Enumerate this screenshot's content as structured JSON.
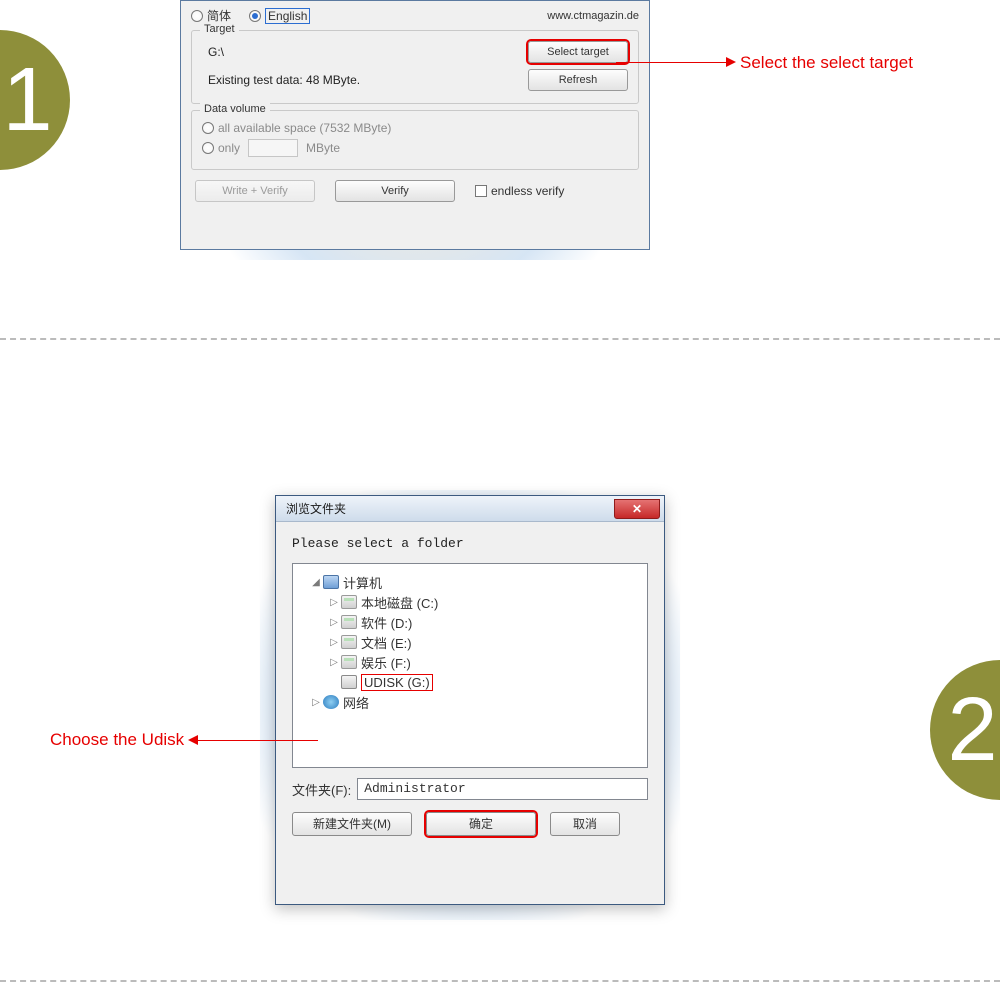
{
  "step1": {
    "badge": "1",
    "lang": {
      "cn": "简体",
      "en": "English"
    },
    "site": "www.ctmagazin.de",
    "target": {
      "group": "Target",
      "drive": "G:\\",
      "select_btn": "Select target",
      "existing": "Existing test data: 48 MByte.",
      "refresh_btn": "Refresh"
    },
    "volume": {
      "group": "Data volume",
      "all": "all available space (7532 MByte)",
      "only": "only",
      "unit": "MByte"
    },
    "actions": {
      "write_verify": "Write + Verify",
      "verify": "Verify",
      "endless": "endless verify"
    },
    "anno": "Select the select target"
  },
  "step2": {
    "badge": "2",
    "title": "浏览文件夹",
    "prompt": "Please select a folder",
    "tree": {
      "computer": "计算机",
      "c": "本地磁盘 (C:)",
      "d": "软件 (D:)",
      "e": "文档 (E:)",
      "f": "娱乐 (F:)",
      "g": "UDISK (G:)",
      "net": "网络"
    },
    "folder_label": "文件夹(F):",
    "folder_value": "Administrator",
    "buttons": {
      "new": "新建文件夹(M)",
      "ok": "确定",
      "cancel": "取消"
    },
    "anno": "Choose the Udisk"
  }
}
